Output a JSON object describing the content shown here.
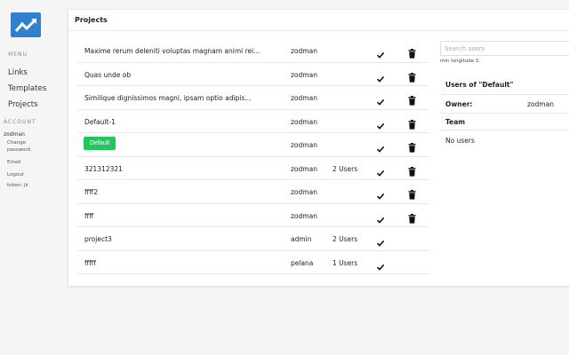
{
  "sidebar": {
    "menu_label": "MENU",
    "links": [
      "Links",
      "Templates",
      "Projects"
    ],
    "account_label": "ACCOUNT",
    "username": "zodman",
    "account_links": [
      "Change",
      "password",
      "Email",
      "Logout",
      "token: jk"
    ]
  },
  "card": {
    "title": "Projects"
  },
  "projects": [
    {
      "name": "Maxime rerum deleniti voluptas magnam animi rei...",
      "owner": "zodman",
      "users": "",
      "trash": true
    },
    {
      "name": "Quas unde ob",
      "owner": "zodman",
      "users": "",
      "trash": true
    },
    {
      "name": "Similique dignissimos magni, ipsam optio adipis...",
      "owner": "zodman",
      "users": "",
      "trash": true
    },
    {
      "name": "Default-1",
      "owner": "zodman",
      "users": "",
      "trash": true
    },
    {
      "name": "Default",
      "owner": "zodman",
      "users": "",
      "trash": true,
      "is_default": true
    },
    {
      "name": "321312321",
      "owner": "zodman",
      "users": "2 Users",
      "trash": true
    },
    {
      "name": "ffff2",
      "owner": "zodman",
      "users": "",
      "trash": true
    },
    {
      "name": "ffff",
      "owner": "zodman",
      "users": "",
      "trash": true
    },
    {
      "name": "project3",
      "owner": "admin",
      "users": "2 Users",
      "trash": false
    },
    {
      "name": "fffff",
      "owner": "pelana",
      "users": "1 Users",
      "trash": false
    }
  ],
  "panel": {
    "search_placeholder": "Search users",
    "hint": "min longitude 3.",
    "title": "Users of \"Default\"",
    "owner_label": "Owner:",
    "owner_value": "zodman",
    "team_label": "Team",
    "no_users": "No users"
  },
  "colors": {
    "logo": "#2f80cf",
    "default_button": "#22c55e"
  },
  "icons": {
    "logo": "trending-up-icon",
    "check": "check-icon",
    "trash": "trash-icon"
  }
}
